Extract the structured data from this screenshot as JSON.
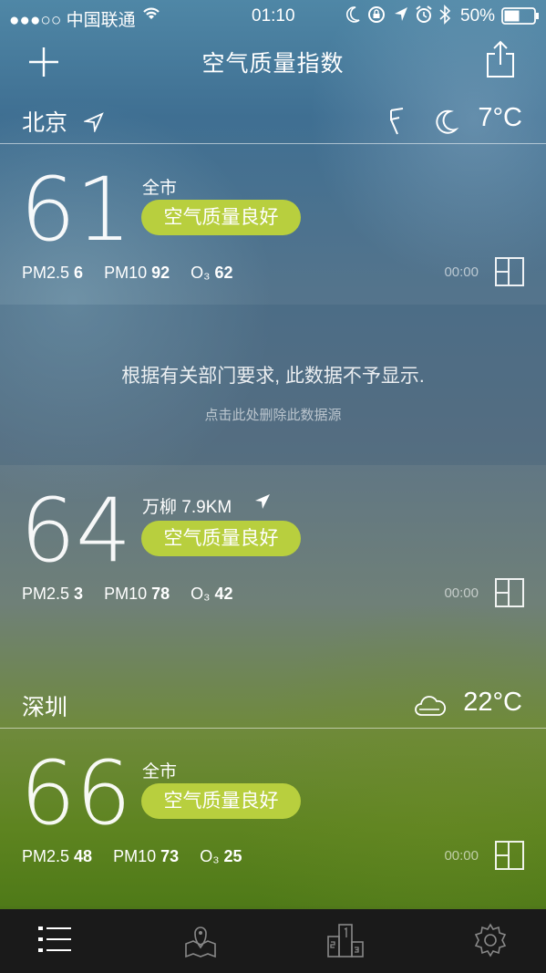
{
  "status_bar": {
    "carrier": "●●●○○ 中国联通",
    "time": "01:10",
    "battery": "50%",
    "icons": [
      "wifi-icon",
      "moon-icon",
      "rotation-lock-icon",
      "location-icon",
      "alarm-icon",
      "bluetooth-icon",
      "battery-icon"
    ]
  },
  "header": {
    "title": "空气质量指数",
    "add_icon": "plus-icon",
    "share_icon": "share-icon"
  },
  "cities": [
    {
      "name": "北京",
      "weather_icon": "moon-icon",
      "temperature": "7°C",
      "stations": [
        {
          "aqi": "61",
          "location": "全市",
          "status": "空气质量良好",
          "pm25_label": "PM2.5",
          "pm25": "6",
          "pm10_label": "PM10",
          "pm10": "92",
          "o3_label": "O₃",
          "o3": "62",
          "time": "00:00"
        }
      ],
      "notice": {
        "text": "根据有关部门要求, 此数据不予显示.",
        "link": "点击此处删除此数据源"
      },
      "station2": {
        "aqi": "64",
        "location": "万柳 7.9KM",
        "status": "空气质量良好",
        "pm25_label": "PM2.5",
        "pm25": "3",
        "pm10_label": "PM10",
        "pm10": "78",
        "o3_label": "O₃",
        "o3": "42",
        "time": "00:00"
      }
    },
    {
      "name": "深圳",
      "weather_icon": "cloud-icon",
      "temperature": "22°C",
      "stations": [
        {
          "aqi": "66",
          "location": "全市",
          "status": "空气质量良好",
          "pm25_label": "PM2.5",
          "pm25": "48",
          "pm10_label": "PM10",
          "pm10": "73",
          "o3_label": "O₃",
          "o3": "25",
          "time": "00:00"
        }
      ]
    }
  ],
  "tabbar": {
    "items": [
      "list-icon",
      "map-icon",
      "ranking-icon",
      "settings-icon"
    ]
  },
  "colors": {
    "good_badge": "#b8cf3e",
    "tabbar": "#1a1a1a"
  }
}
